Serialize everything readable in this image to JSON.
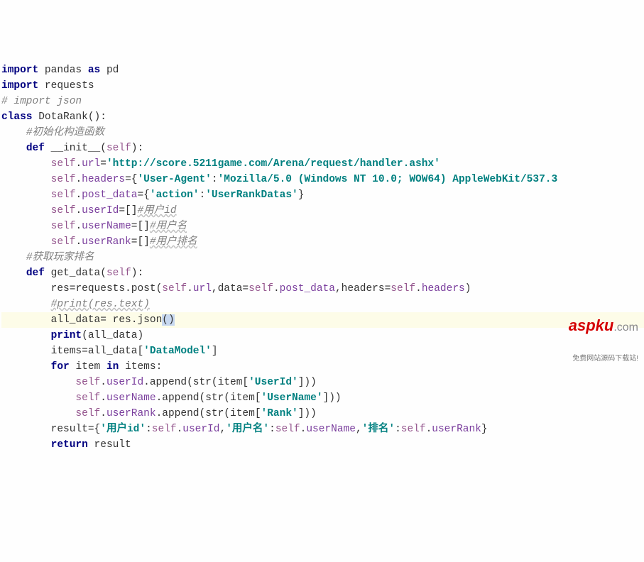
{
  "code": {
    "lines": [
      {
        "indent": 0,
        "tokens": [
          {
            "t": "kw",
            "v": "import"
          },
          {
            "t": "sp",
            "v": " "
          },
          {
            "t": "name",
            "v": "pandas"
          },
          {
            "t": "sp",
            "v": " "
          },
          {
            "t": "kw",
            "v": "as"
          },
          {
            "t": "sp",
            "v": " "
          },
          {
            "t": "name",
            "v": "pd"
          }
        ]
      },
      {
        "indent": 0,
        "tokens": [
          {
            "t": "kw",
            "v": "import"
          },
          {
            "t": "sp",
            "v": " "
          },
          {
            "t": "name",
            "v": "requests"
          }
        ]
      },
      {
        "indent": 0,
        "tokens": [
          {
            "t": "cmt",
            "v": "# import json"
          }
        ]
      },
      {
        "indent": 0,
        "tokens": [
          {
            "t": "kw",
            "v": "class"
          },
          {
            "t": "sp",
            "v": " "
          },
          {
            "t": "cls",
            "v": "DotaRank"
          },
          {
            "t": "pun",
            "v": "():"
          }
        ]
      },
      {
        "indent": 1,
        "tokens": [
          {
            "t": "cmt",
            "v": "#初始化构造函数"
          }
        ]
      },
      {
        "indent": 1,
        "tokens": [
          {
            "t": "kw",
            "v": "def"
          },
          {
            "t": "sp",
            "v": " "
          },
          {
            "t": "func",
            "v": "__init__"
          },
          {
            "t": "pun",
            "v": "("
          },
          {
            "t": "self",
            "v": "self"
          },
          {
            "t": "pun",
            "v": "):"
          }
        ]
      },
      {
        "indent": 2,
        "tokens": [
          {
            "t": "self",
            "v": "self"
          },
          {
            "t": "pun",
            "v": "."
          },
          {
            "t": "prop",
            "v": "url"
          },
          {
            "t": "pun",
            "v": "="
          },
          {
            "t": "str",
            "v": "'http://score.5211game.com/Arena/request/handler.ashx'"
          }
        ]
      },
      {
        "indent": 2,
        "tokens": [
          {
            "t": "self",
            "v": "self"
          },
          {
            "t": "pun",
            "v": "."
          },
          {
            "t": "prop",
            "v": "headers"
          },
          {
            "t": "pun",
            "v": "={"
          },
          {
            "t": "str",
            "v": "'User-Agent'"
          },
          {
            "t": "pun",
            "v": ":"
          },
          {
            "t": "str",
            "v": "'Mozilla/5.0 (Windows NT 10.0; WOW64) AppleWebKit/537.3"
          }
        ]
      },
      {
        "indent": 2,
        "tokens": [
          {
            "t": "self",
            "v": "self"
          },
          {
            "t": "pun",
            "v": "."
          },
          {
            "t": "prop",
            "v": "post_data"
          },
          {
            "t": "pun",
            "v": "={"
          },
          {
            "t": "str",
            "v": "'action'"
          },
          {
            "t": "pun",
            "v": ":"
          },
          {
            "t": "str",
            "v": "'UserRankDatas'"
          },
          {
            "t": "pun",
            "v": "}"
          }
        ]
      },
      {
        "indent": 2,
        "tokens": [
          {
            "t": "self",
            "v": "self"
          },
          {
            "t": "pun",
            "v": "."
          },
          {
            "t": "prop",
            "v": "userId"
          },
          {
            "t": "pun",
            "v": "=[]"
          },
          {
            "t": "cmtsq",
            "v": "#用户id"
          }
        ]
      },
      {
        "indent": 2,
        "tokens": [
          {
            "t": "self",
            "v": "self"
          },
          {
            "t": "pun",
            "v": "."
          },
          {
            "t": "prop",
            "v": "userName"
          },
          {
            "t": "pun",
            "v": "=[]"
          },
          {
            "t": "cmtsq",
            "v": "#用户名"
          }
        ]
      },
      {
        "indent": 2,
        "tokens": [
          {
            "t": "self",
            "v": "self"
          },
          {
            "t": "pun",
            "v": "."
          },
          {
            "t": "prop",
            "v": "userRank"
          },
          {
            "t": "pun",
            "v": "=[]"
          },
          {
            "t": "cmtsq",
            "v": "#用户排名"
          }
        ]
      },
      {
        "indent": 1,
        "tokens": [
          {
            "t": "cmt",
            "v": "#获取玩家排名"
          }
        ]
      },
      {
        "indent": 1,
        "tokens": [
          {
            "t": "kw",
            "v": "def"
          },
          {
            "t": "sp",
            "v": " "
          },
          {
            "t": "func",
            "v": "get_data"
          },
          {
            "t": "pun",
            "v": "("
          },
          {
            "t": "self",
            "v": "self"
          },
          {
            "t": "pun",
            "v": "):"
          }
        ]
      },
      {
        "indent": 2,
        "tokens": [
          {
            "t": "name",
            "v": "res"
          },
          {
            "t": "pun",
            "v": "="
          },
          {
            "t": "name",
            "v": "requests"
          },
          {
            "t": "pun",
            "v": "."
          },
          {
            "t": "name",
            "v": "post"
          },
          {
            "t": "pun",
            "v": "("
          },
          {
            "t": "self",
            "v": "self"
          },
          {
            "t": "pun",
            "v": "."
          },
          {
            "t": "prop",
            "v": "url"
          },
          {
            "t": "pun",
            "v": ","
          },
          {
            "t": "name",
            "v": "data"
          },
          {
            "t": "pun",
            "v": "="
          },
          {
            "t": "self",
            "v": "self"
          },
          {
            "t": "pun",
            "v": "."
          },
          {
            "t": "prop",
            "v": "post_data"
          },
          {
            "t": "pun",
            "v": ","
          },
          {
            "t": "name",
            "v": "headers"
          },
          {
            "t": "pun",
            "v": "="
          },
          {
            "t": "self",
            "v": "self"
          },
          {
            "t": "pun",
            "v": "."
          },
          {
            "t": "prop",
            "v": "headers"
          },
          {
            "t": "pun",
            "v": ")"
          }
        ]
      },
      {
        "indent": 2,
        "tokens": [
          {
            "t": "cmtsq",
            "v": "#print(res.text)"
          }
        ]
      },
      {
        "indent": 2,
        "highlight": true,
        "tokens": [
          {
            "t": "name",
            "v": "all_data"
          },
          {
            "t": "pun",
            "v": "= "
          },
          {
            "t": "name",
            "v": "res"
          },
          {
            "t": "pun",
            "v": "."
          },
          {
            "t": "name",
            "v": "json"
          },
          {
            "t": "hlp",
            "v": "()"
          }
        ]
      },
      {
        "indent": 2,
        "tokens": [
          {
            "t": "kw",
            "v": "print"
          },
          {
            "t": "pun",
            "v": "("
          },
          {
            "t": "name",
            "v": "all_data"
          },
          {
            "t": "pun",
            "v": ")"
          }
        ]
      },
      {
        "indent": 2,
        "tokens": [
          {
            "t": "name",
            "v": "items"
          },
          {
            "t": "pun",
            "v": "="
          },
          {
            "t": "name",
            "v": "all_data"
          },
          {
            "t": "pun",
            "v": "["
          },
          {
            "t": "str",
            "v": "'DataModel'"
          },
          {
            "t": "pun",
            "v": "]"
          }
        ]
      },
      {
        "indent": 2,
        "tokens": [
          {
            "t": "kw",
            "v": "for"
          },
          {
            "t": "sp",
            "v": " "
          },
          {
            "t": "name",
            "v": "item"
          },
          {
            "t": "sp",
            "v": " "
          },
          {
            "t": "kw",
            "v": "in"
          },
          {
            "t": "sp",
            "v": " "
          },
          {
            "t": "name",
            "v": "items"
          },
          {
            "t": "pun",
            "v": ":"
          }
        ]
      },
      {
        "indent": 3,
        "tokens": [
          {
            "t": "self",
            "v": "self"
          },
          {
            "t": "pun",
            "v": "."
          },
          {
            "t": "prop",
            "v": "userId"
          },
          {
            "t": "pun",
            "v": "."
          },
          {
            "t": "name",
            "v": "append"
          },
          {
            "t": "pun",
            "v": "("
          },
          {
            "t": "name",
            "v": "str"
          },
          {
            "t": "pun",
            "v": "("
          },
          {
            "t": "name",
            "v": "item"
          },
          {
            "t": "pun",
            "v": "["
          },
          {
            "t": "str",
            "v": "'UserId'"
          },
          {
            "t": "pun",
            "v": "]))"
          }
        ]
      },
      {
        "indent": 3,
        "tokens": [
          {
            "t": "self",
            "v": "self"
          },
          {
            "t": "pun",
            "v": "."
          },
          {
            "t": "prop",
            "v": "userName"
          },
          {
            "t": "pun",
            "v": "."
          },
          {
            "t": "name",
            "v": "append"
          },
          {
            "t": "pun",
            "v": "("
          },
          {
            "t": "name",
            "v": "str"
          },
          {
            "t": "pun",
            "v": "("
          },
          {
            "t": "name",
            "v": "item"
          },
          {
            "t": "pun",
            "v": "["
          },
          {
            "t": "str",
            "v": "'UserName'"
          },
          {
            "t": "pun",
            "v": "]))"
          }
        ]
      },
      {
        "indent": 3,
        "tokens": [
          {
            "t": "self",
            "v": "self"
          },
          {
            "t": "pun",
            "v": "."
          },
          {
            "t": "prop",
            "v": "userRank"
          },
          {
            "t": "pun",
            "v": "."
          },
          {
            "t": "name",
            "v": "append"
          },
          {
            "t": "pun",
            "v": "("
          },
          {
            "t": "name",
            "v": "str"
          },
          {
            "t": "pun",
            "v": "("
          },
          {
            "t": "name",
            "v": "item"
          },
          {
            "t": "pun",
            "v": "["
          },
          {
            "t": "str",
            "v": "'Rank'"
          },
          {
            "t": "pun",
            "v": "]))"
          }
        ]
      },
      {
        "indent": 2,
        "tokens": [
          {
            "t": "name",
            "v": "result"
          },
          {
            "t": "pun",
            "v": "={"
          },
          {
            "t": "str",
            "v": "'用户id'"
          },
          {
            "t": "pun",
            "v": ":"
          },
          {
            "t": "self",
            "v": "self"
          },
          {
            "t": "pun",
            "v": "."
          },
          {
            "t": "prop",
            "v": "userId"
          },
          {
            "t": "pun",
            "v": ","
          },
          {
            "t": "str",
            "v": "'用户名'"
          },
          {
            "t": "pun",
            "v": ":"
          },
          {
            "t": "self",
            "v": "self"
          },
          {
            "t": "pun",
            "v": "."
          },
          {
            "t": "prop",
            "v": "userName"
          },
          {
            "t": "pun",
            "v": ","
          },
          {
            "t": "str",
            "v": "'排名'"
          },
          {
            "t": "pun",
            "v": ":"
          },
          {
            "t": "self",
            "v": "self"
          },
          {
            "t": "pun",
            "v": "."
          },
          {
            "t": "prop",
            "v": "userRank"
          },
          {
            "t": "pun",
            "v": "}"
          }
        ]
      },
      {
        "indent": 2,
        "tokens": [
          {
            "t": "kw",
            "v": "return"
          },
          {
            "t": "sp",
            "v": " "
          },
          {
            "t": "name",
            "v": "result"
          }
        ]
      }
    ]
  },
  "watermark": {
    "main": "aspku",
    "dot": ".com",
    "sub": "免费网站源码下载站!"
  }
}
